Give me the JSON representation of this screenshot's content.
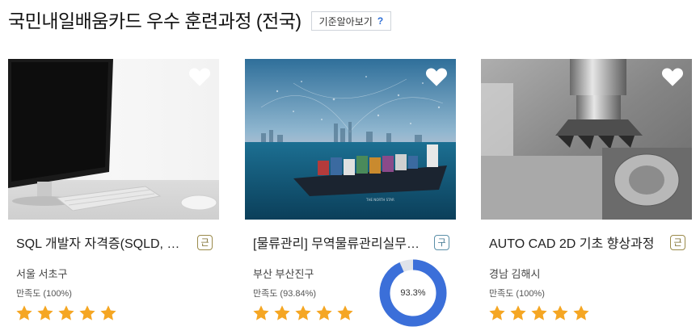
{
  "header": {
    "title": "국민내일배움카드 우수 훈련과정 (전국)",
    "criteria_button": "기준알아보기",
    "help_mark": "?"
  },
  "cards": [
    {
      "title": "SQL 개발자 자격증(SQLD, …",
      "badge": "근",
      "location": "서울 서초구",
      "satisfaction": "만족도 (100%)",
      "rating": 5,
      "image": "desktop-computer-keyboard-photo"
    },
    {
      "title": "[물류관리] 무역물류관리실무…",
      "badge": "구",
      "location": "부산 부산진구",
      "satisfaction": "만족도 (93.84%)",
      "rating": 5,
      "image": "container-ship-night-city-photo"
    },
    {
      "title": "AUTO CAD 2D 기초 향상과정",
      "badge": "근",
      "location": "경남 김해시",
      "satisfaction": "만족도 (100%)",
      "rating": 5,
      "image": "cnc-milling-machine-photo"
    }
  ],
  "donut": {
    "label": "93.3%",
    "fraction": 0.933,
    "color": "#3b6fd9",
    "track_color": "#dfe3ea"
  },
  "colors": {
    "star": "#f5a623",
    "heart": "#ffffff"
  },
  "icons": [
    "heart-icon",
    "star-icon",
    "help-icon"
  ]
}
